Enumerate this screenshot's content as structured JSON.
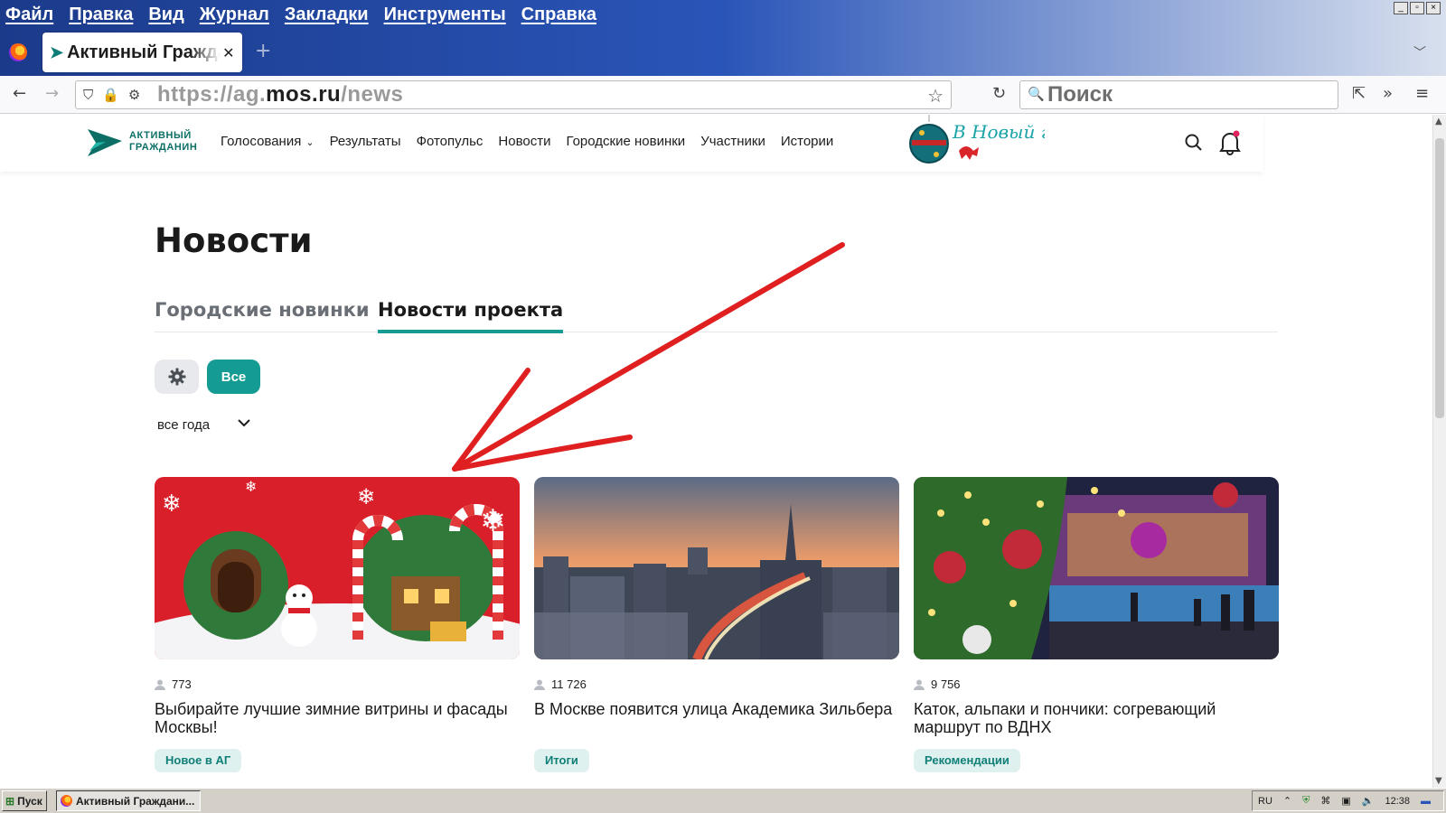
{
  "window": {
    "menu": [
      "Файл",
      "Правка",
      "Вид",
      "Журнал",
      "Закладки",
      "Инструменты",
      "Справка"
    ],
    "controls": [
      "_",
      "▫",
      "×"
    ]
  },
  "browser": {
    "tab_title": "Активный Гражданин",
    "address": {
      "scheme": "https://",
      "host_prefix": "ag.",
      "host_main": "mos.ru",
      "path": "/news"
    },
    "search_placeholder": "Поиск"
  },
  "site": {
    "logo_line1": "АКТИВНЫЙ",
    "logo_line2": "ГРАЖДАНИН",
    "nav": [
      "Голосования",
      "Результаты",
      "Фотопульс",
      "Новости",
      "Городские новинки",
      "Участники",
      "Истории"
    ],
    "banner_text": "В Новый год!"
  },
  "page": {
    "title": "Новости",
    "tabs": [
      {
        "label": "Городские новинки",
        "active": false
      },
      {
        "label": "Новости проекта",
        "active": true
      }
    ],
    "filter_all_label": "Все",
    "year_select": "все года",
    "cards": [
      {
        "views": "773",
        "title": "Выбирайте лучшие зимние витрины и фасады Москвы!",
        "tag": "Новое в АГ"
      },
      {
        "views": "11 726",
        "title": "В Москве появится улица Академика Зильбера",
        "tag": "Итоги"
      },
      {
        "views": "9 756",
        "title": "Каток, альпаки и пончики: согревающий маршрут по ВДНХ",
        "tag": "Рекомендации"
      }
    ]
  },
  "taskbar": {
    "start_label": "Пуск",
    "task_label": "Активный Граждани...",
    "lang": "RU",
    "clock": "12:38"
  },
  "colors": {
    "accent": "#149c94",
    "tag_bg": "#dff1ef",
    "annotation": "#e02020"
  }
}
